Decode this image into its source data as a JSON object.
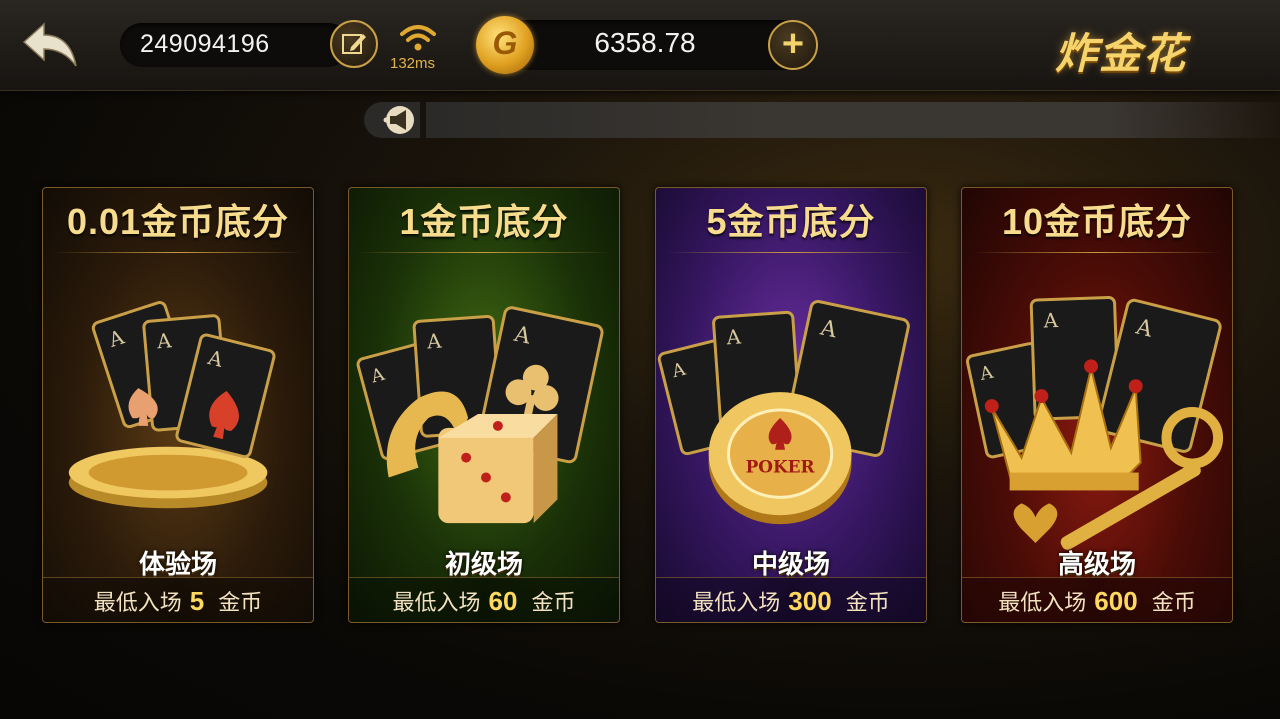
{
  "header": {
    "user_id": "249094196",
    "ping": "132ms",
    "coin_symbol": "G",
    "balance": "6358.78",
    "add_label": "+",
    "game_title": "炸金花"
  },
  "rooms": [
    {
      "stake": "0.01金币底分",
      "level": "体验场",
      "min_prefix": "最低入场",
      "min_value": "5",
      "min_suffix": "金币"
    },
    {
      "stake": "1金币底分",
      "level": "初级场",
      "min_prefix": "最低入场",
      "min_value": "60",
      "min_suffix": "金币"
    },
    {
      "stake": "5金币底分",
      "level": "中级场",
      "min_prefix": "最低入场",
      "min_value": "300",
      "min_suffix": "金币"
    },
    {
      "stake": "10金币底分",
      "level": "高级场",
      "min_prefix": "最低入场",
      "min_value": "600",
      "min_suffix": "金币"
    }
  ],
  "art_labels": {
    "card_rank": "A",
    "chip_text": "POKER"
  },
  "colors": {
    "gold": "#f7d46b",
    "accent_brown": "#c9a048"
  }
}
